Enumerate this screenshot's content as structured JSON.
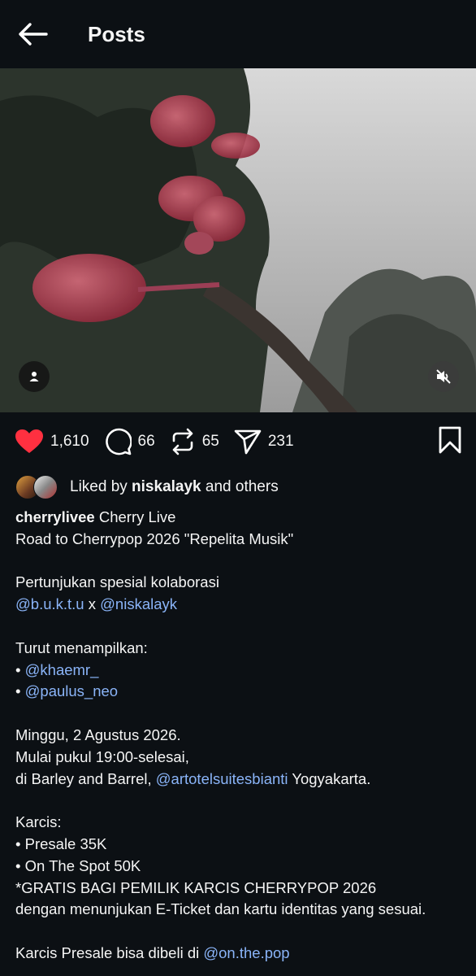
{
  "header": {
    "title": "Posts"
  },
  "post": {
    "likes": "1,610",
    "comments": "66",
    "reposts": "65",
    "shares": "231",
    "liked_by_prefix": "Liked by ",
    "liked_by_user": "niskalayk",
    "liked_by_suffix": " and others",
    "username": "cherrylivee",
    "display_name": "Cherry Live",
    "caption": {
      "line1": "Road to Cherrypop 2026 \"Repelita Musik\"",
      "line2": "Pertunjukan spesial kolaborasi",
      "mention1": "@b.u.k.t.u",
      "x_sep": " x ",
      "mention2": "@niskalayk",
      "line4": "Turut menampilkan:",
      "bullet": "• ",
      "mention3": "@khaemr_",
      "mention4": "@paulus_neo",
      "line7": "Minggu, 2 Agustus 2026.",
      "line8": "Mulai pukul 19:00-selesai,",
      "line9_prefix": "di Barley and Barrel, ",
      "mention5": "@artotelsuitesbianti",
      "line9_suffix": " Yogyakarta.",
      "line10": "Karcis:",
      "line11": "• Presale 35K",
      "line12": "• On The Spot 50K",
      "line13": "*GRATIS BAGI PEMILIK KARCIS CHERRYPOP 2026",
      "line14": "dengan menunjukan E-Ticket dan kartu identitas yang sesuai.",
      "line15_prefix": "Karcis Presale bisa dibeli di ",
      "mention6": "@on.the.pop"
    }
  },
  "colors": {
    "background": "#0c1014",
    "like_red": "#ff3040",
    "mention_blue": "#8ab4f8"
  },
  "icons": [
    "back-arrow-icon",
    "user-tag-icon",
    "muted-speaker-icon",
    "heart-icon",
    "comment-icon",
    "repost-icon",
    "share-icon",
    "bookmark-icon"
  ]
}
